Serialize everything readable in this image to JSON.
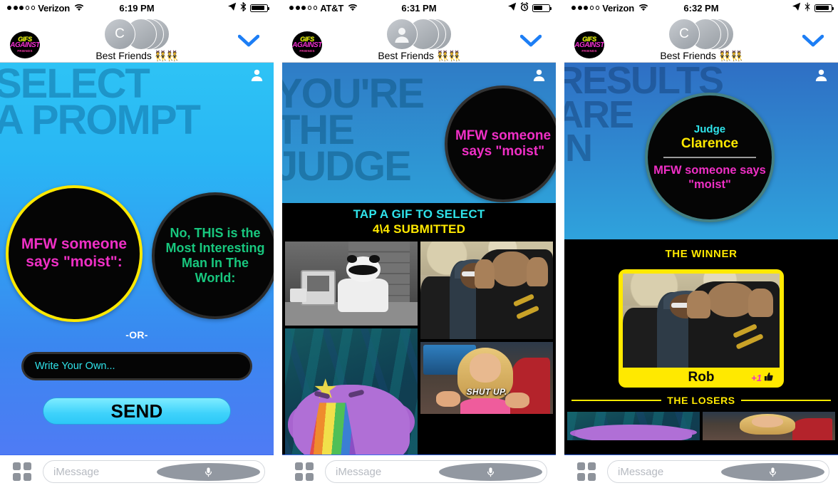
{
  "app": {
    "logo_line1": "GIFS",
    "logo_line2": "AGAINST",
    "logo_line3": "FRIENDS",
    "conversation_title": "Best Friends",
    "conversation_emoji": "👯👯",
    "avatar_initial": "C",
    "chevron_icon": "chevron-down-icon",
    "person_icon": "person-icon",
    "imessage_placeholder": "iMessage",
    "apps_icon": "apps-grid-icon",
    "mic_icon": "microphone-icon"
  },
  "panels": [
    {
      "status": {
        "carrier": "Verizon",
        "time": "6:19 PM",
        "signal_filled": 3,
        "signal_total": 5,
        "wifi_icon": "wifi-icon",
        "location_icon": "location-arrow-icon",
        "secondary_icon": "bluetooth-icon",
        "battery_level": 88
      },
      "screen": {
        "headline": "SELECT\nA PROMPT",
        "prompts": [
          {
            "text": "MFW someone says \"moist\":",
            "color": "#ef2fc5",
            "selected": true,
            "border": "#ffe900"
          },
          {
            "text": "No, THIS is the Most Interesting Man In The World:",
            "color": "#18c77e",
            "selected": false,
            "border": "rgba(255,255,255,.15)"
          }
        ],
        "or_label": "-OR-",
        "write_own_placeholder": "Write Your Own...",
        "send_label": "SEND"
      }
    },
    {
      "status": {
        "carrier": "AT&T",
        "time": "6:31 PM",
        "signal_filled": 3,
        "signal_total": 5,
        "wifi_icon": "wifi-icon",
        "location_icon": "location-arrow-icon",
        "secondary_icon": "alarm-clock-icon",
        "battery_level": 58
      },
      "screen": {
        "headline": "YOU'RE\nTHE\nJUDGE",
        "prompt_bubble": "MFW someone says \"moist\"",
        "tap_label": "TAP A GIF TO SELECT",
        "submitted_label": "4\\4 SUBMITTED",
        "gifs": [
          {
            "name": "panda-at-computer-gif",
            "caption": ""
          },
          {
            "name": "two-guys-hands-on-head-gif",
            "caption": ""
          },
          {
            "name": "lumpy-space-princess-rainbow-gif",
            "caption": ""
          },
          {
            "name": "shut-up-blonde-woman-gif",
            "caption": "SHUT UP."
          }
        ]
      }
    },
    {
      "status": {
        "carrier": "Verizon",
        "time": "6:32 PM",
        "signal_filled": 3,
        "signal_total": 5,
        "wifi_icon": "wifi-icon",
        "location_icon": "location-arrow-icon",
        "secondary_icon": "bluetooth-icon",
        "battery_level": 88
      },
      "screen": {
        "headline": "RESULTS\nARE\nIN",
        "judge_label": "Judge",
        "judge_name": "Clarence",
        "prompt_bubble": "MFW someone says \"moist\"",
        "winner_label": "THE WINNER",
        "winner_name": "Rob",
        "winner_points": "+1",
        "winner_points_icon": "thumbs-up-icon",
        "winner_gif": "two-guys-hands-on-head-gif",
        "losers_label": "THE LOSERS",
        "loser_gifs": [
          {
            "name": "lumpy-space-princess-rainbow-gif"
          },
          {
            "name": "shut-up-blonde-woman-gif"
          }
        ]
      }
    }
  ],
  "colors": {
    "magenta": "#ef2fc5",
    "green": "#18c77e",
    "yellow": "#ffe900",
    "cyan": "#2fe3ea",
    "imessage_blue": "#3c6cf0"
  }
}
